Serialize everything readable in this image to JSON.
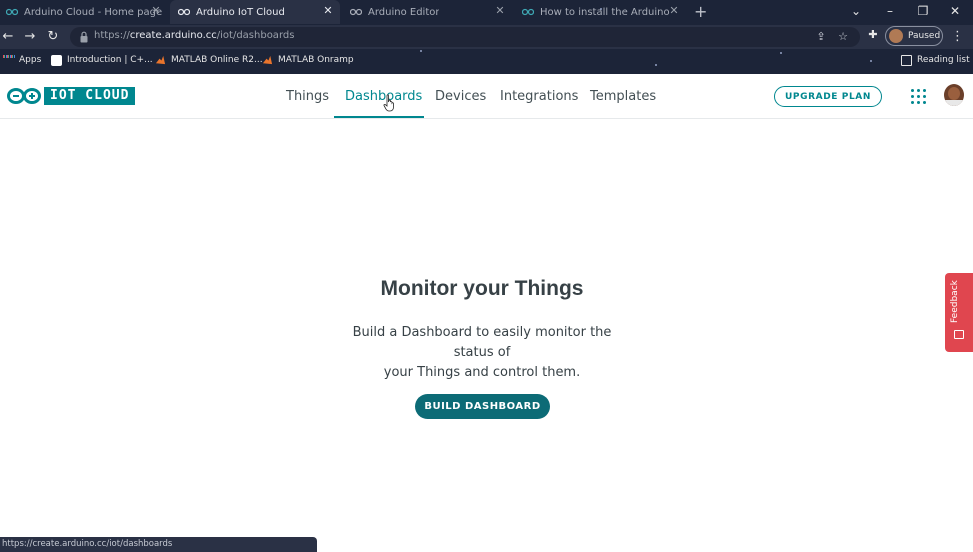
{
  "browser": {
    "tabs": [
      {
        "title": "Arduino Cloud - Home page",
        "active": false,
        "icon": "arduino-icon"
      },
      {
        "title": "Arduino IoT Cloud",
        "active": true,
        "icon": "arduino-icon"
      },
      {
        "title": "Arduino Editor",
        "active": false,
        "icon": "arduino-icon"
      },
      {
        "title": "How to install the Arduino Creat",
        "active": false,
        "icon": "arduino-icon"
      }
    ],
    "url_prefix": "https://",
    "url_host": "create.arduino.cc",
    "url_path": "/iot/dashboards",
    "profile_status": "Paused",
    "bookmarks": [
      {
        "label": "Apps",
        "icon": "apps-grid-icon"
      },
      {
        "label": "Introduction | C+...",
        "icon": "bookmark-favicon"
      },
      {
        "label": "MATLAB Online R2...",
        "icon": "matlab-icon"
      },
      {
        "label": "MATLAB Onramp",
        "icon": "matlab-icon"
      }
    ],
    "reading_list": "Reading list",
    "status_url": "https://create.arduino.cc/iot/dashboards"
  },
  "app": {
    "logo_text": "IOT CLOUD",
    "brand_color": "#00878f",
    "nav": [
      {
        "label": "Things",
        "active": false
      },
      {
        "label": "Dashboards",
        "active": true
      },
      {
        "label": "Devices",
        "active": false
      },
      {
        "label": "Integrations",
        "active": false
      },
      {
        "label": "Templates",
        "active": false
      }
    ],
    "upgrade_label": "UPGRADE PLAN"
  },
  "main": {
    "title": "Monitor your Things",
    "description_line1": "Build a Dashboard to easily monitor the status of",
    "description_line2": "your Things and control them.",
    "cta_label": "BUILD DASHBOARD"
  },
  "feedback_label": "Feedback",
  "accent_colors": {
    "feedback": "#e0464f",
    "cta": "#0c6b76"
  }
}
